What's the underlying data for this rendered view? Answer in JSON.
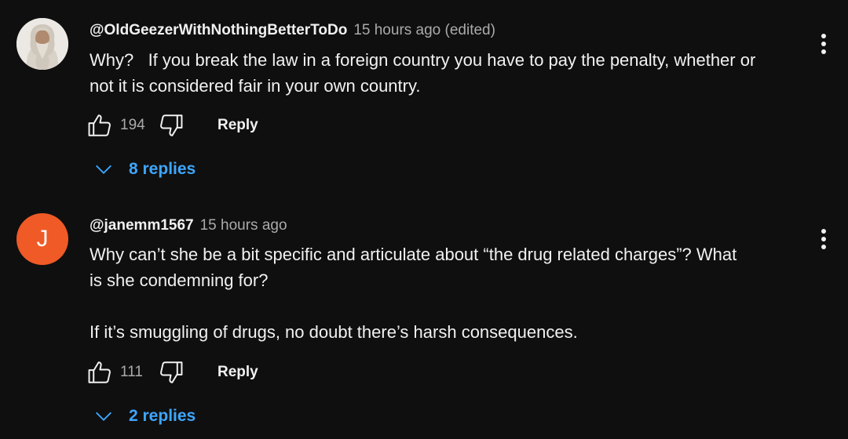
{
  "comments": [
    {
      "author": "@OldGeezerWithNothingBetterToDo",
      "meta": "15 hours ago (edited)",
      "avatar": "photo",
      "text": "Why?   If you break the law in a foreign country you have to pay the penalty, whether or\nnot it is considered fair in your own country.",
      "likes": "194",
      "reply_label": "Reply",
      "replies_label": "8 replies"
    },
    {
      "author": "@janemm1567",
      "meta": "15 hours ago",
      "avatar_letter": "J",
      "avatar_color": "#ef5a26",
      "text": "Why can’t she be a bit specific and articulate about “the drug related charges”? What\nis she condemning for?\n\nIf it’s smuggling of drugs, no doubt there’s harsh consequences.",
      "likes": "111",
      "reply_label": "Reply",
      "replies_label": "2 replies"
    }
  ],
  "icons": {
    "like": "thumbs-up-icon",
    "dislike": "thumbs-down-icon",
    "more": "more-vert-icon",
    "expand": "chevron-down-icon"
  },
  "colors": {
    "background": "#0f0f0f",
    "link": "#3ea6ff",
    "secondary_text": "#aaaaaa"
  }
}
